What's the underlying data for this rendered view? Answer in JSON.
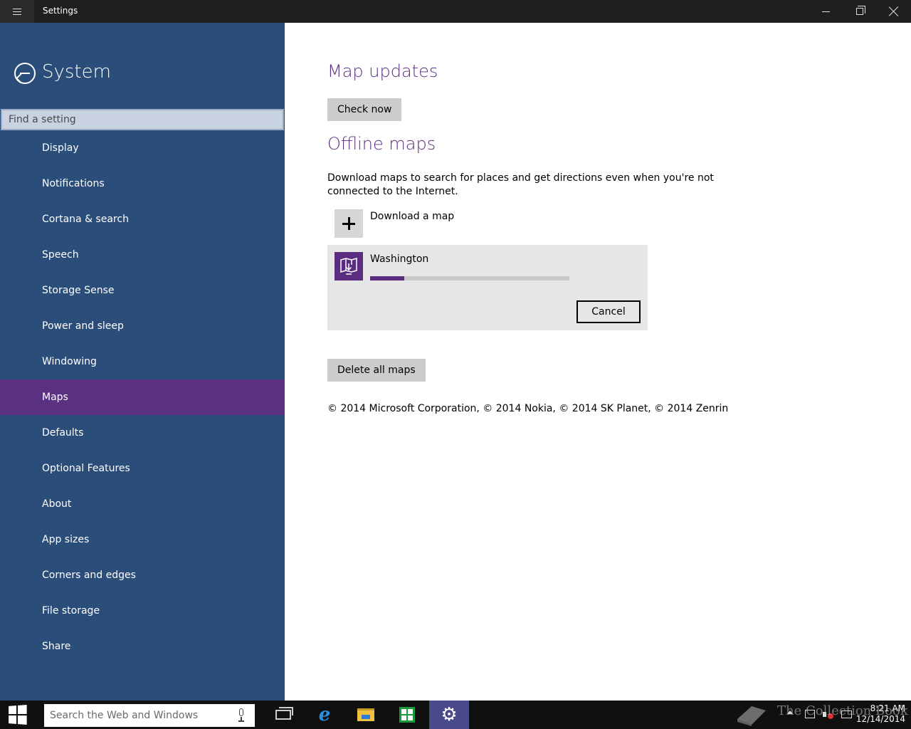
{
  "window": {
    "title": "Settings"
  },
  "sidebar": {
    "section_title": "System",
    "search_placeholder": "Find a setting",
    "items": [
      {
        "label": "Display"
      },
      {
        "label": "Notifications"
      },
      {
        "label": "Cortana & search"
      },
      {
        "label": "Speech"
      },
      {
        "label": "Storage Sense"
      },
      {
        "label": "Power and sleep"
      },
      {
        "label": "Windowing"
      },
      {
        "label": "Maps",
        "active": true
      },
      {
        "label": "Defaults"
      },
      {
        "label": "Optional Features"
      },
      {
        "label": "About"
      },
      {
        "label": "App sizes"
      },
      {
        "label": "Corners and edges"
      },
      {
        "label": "File storage"
      },
      {
        "label": "Share"
      }
    ]
  },
  "main": {
    "map_updates": {
      "heading": "Map updates",
      "check_now_label": "Check now"
    },
    "offline_maps": {
      "heading": "Offline maps",
      "description": "Download maps to search for places and get directions even when you're not connected to the Internet.",
      "download_label": "Download a map",
      "download_item": {
        "name": "Washington",
        "progress_fraction": 0.17,
        "cancel_label": "Cancel"
      },
      "delete_all_label": "Delete all maps"
    },
    "copyright": "© 2014 Microsoft Corporation, © 2014 Nokia, © 2014 SK Planet, © 2014 Zenrin"
  },
  "taskbar": {
    "search_placeholder": "Search the Web and Windows",
    "clock_time": "8:21 AM",
    "clock_date": "12/14/2014"
  },
  "watermark": "The Collection Book",
  "colors": {
    "sidebar_bg": "#2b4d79",
    "accent": "#5b2d80",
    "titlebar_bg": "#1f1f1f",
    "taskbar_bg": "#101010"
  }
}
